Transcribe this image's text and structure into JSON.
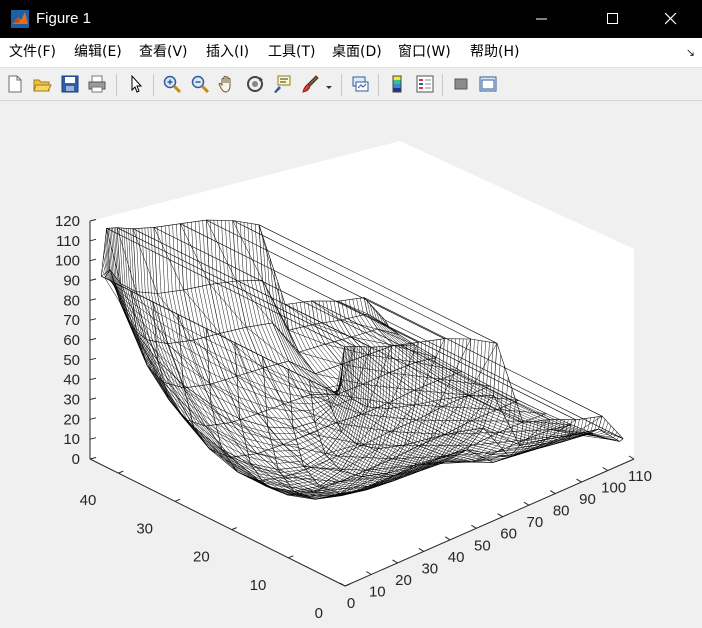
{
  "window": {
    "title": "Figure 1"
  },
  "menu": [
    {
      "label": "文件(F)",
      "name": "menu-file"
    },
    {
      "label": "编辑(E)",
      "name": "menu-edit"
    },
    {
      "label": "查看(V)",
      "name": "menu-view"
    },
    {
      "label": "插入(I)",
      "name": "menu-insert"
    },
    {
      "label": "工具(T)",
      "name": "menu-tools"
    },
    {
      "label": "桌面(D)",
      "name": "menu-desktop"
    },
    {
      "label": "窗口(W)",
      "name": "menu-window"
    },
    {
      "label": "帮助(H)",
      "name": "menu-help"
    }
  ],
  "toolbar": {
    "icons": [
      "new-figure-icon",
      "open-file-icon",
      "save-icon",
      "print-icon",
      "edit-plot-arrow-icon",
      "zoom-in-icon",
      "zoom-out-icon",
      "pan-hand-icon",
      "rotate-3d-icon",
      "data-cursor-icon",
      "brush-icon",
      "brush-dropdown-icon",
      "link-plot-icon",
      "colorbar-icon",
      "legend-icon",
      "hide-plot-tools-icon",
      "show-plot-tools-icon"
    ]
  },
  "chart_data": {
    "type": "mesh3d",
    "title": "",
    "xlabel": "",
    "ylabel": "",
    "zlabel": "",
    "x_ticks": [
      "0",
      "10",
      "20",
      "30",
      "40",
      "50",
      "60",
      "70",
      "80",
      "90",
      "100",
      "110"
    ],
    "y_ticks": [
      "0",
      "10",
      "20",
      "30",
      "40"
    ],
    "z_ticks": [
      "0",
      "10",
      "20",
      "30",
      "40",
      "50",
      "60",
      "70",
      "80",
      "90",
      "100",
      "110",
      "120"
    ],
    "xlim": [
      0,
      110
    ],
    "ylim": [
      0,
      45
    ],
    "zlim": [
      0,
      120
    ],
    "grid": false,
    "mesh_color": "#000000",
    "axes_background": "#ffffff",
    "sections": [
      {
        "x": 0,
        "z_bottom": 95,
        "z_top": 95
      },
      {
        "x": 2,
        "z_bottom": 55,
        "z_top": 118
      },
      {
        "x": 6,
        "z_bottom": 30,
        "z_top": 116
      },
      {
        "x": 12,
        "z_bottom": 15,
        "z_top": 112
      },
      {
        "x": 20,
        "z_bottom": 6,
        "z_top": 108
      },
      {
        "x": 30,
        "z_bottom": 2,
        "z_top": 104
      },
      {
        "x": 40,
        "z_bottom": 1,
        "z_top": 100
      },
      {
        "x": 50,
        "z_bottom": 1,
        "z_top": 94
      },
      {
        "x": 60,
        "z_bottom": 1,
        "z_top": 86
      },
      {
        "x": 70,
        "z_bottom": 2,
        "z_top": 40
      },
      {
        "x": 80,
        "z_bottom": 2,
        "z_top": 36
      },
      {
        "x": 90,
        "z_bottom": 3,
        "z_top": 30
      },
      {
        "x": 100,
        "z_bottom": 3,
        "z_top": 26
      },
      {
        "x": 108,
        "z_bottom": 3,
        "z_top": 10
      }
    ]
  }
}
